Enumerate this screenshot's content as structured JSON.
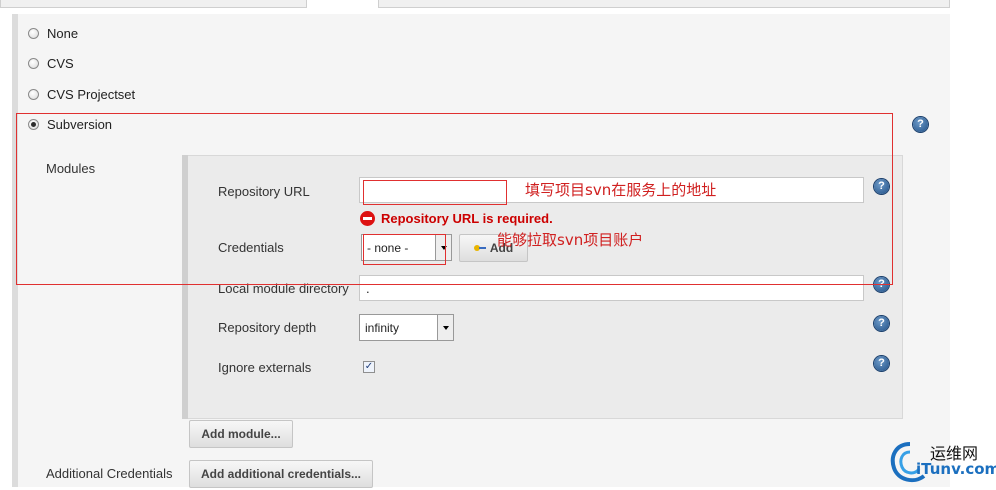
{
  "scm_options": [
    {
      "label": "None",
      "checked": false
    },
    {
      "label": "CVS",
      "checked": false
    },
    {
      "label": "CVS Projectset",
      "checked": false
    },
    {
      "label": "Subversion",
      "checked": true
    }
  ],
  "modules_label": "Modules",
  "repository_url": {
    "label": "Repository URL",
    "value": ""
  },
  "error_message": "Repository URL is required.",
  "credentials": {
    "label": "Credentials",
    "selected": "- none -",
    "add_button": "Add"
  },
  "local_module_directory": {
    "label": "Local module directory",
    "value": "."
  },
  "repository_depth": {
    "label": "Repository depth",
    "selected": "infinity"
  },
  "ignore_externals": {
    "label": "Ignore externals",
    "checked": true
  },
  "add_module_button": "Add module...",
  "additional_credentials": {
    "label": "Additional Credentials",
    "button": "Add additional credentials..."
  },
  "help_glyph": "?",
  "annotations": {
    "url_note": "填写项目svn在服务上的地址",
    "credentials_note": "能够拉取svn项目账户"
  },
  "watermark": {
    "line1": "运维网",
    "line2": "iTunv.com"
  },
  "colors": {
    "annotation": "#e03030",
    "error": "#cc0000",
    "help": "#1f4f86"
  }
}
